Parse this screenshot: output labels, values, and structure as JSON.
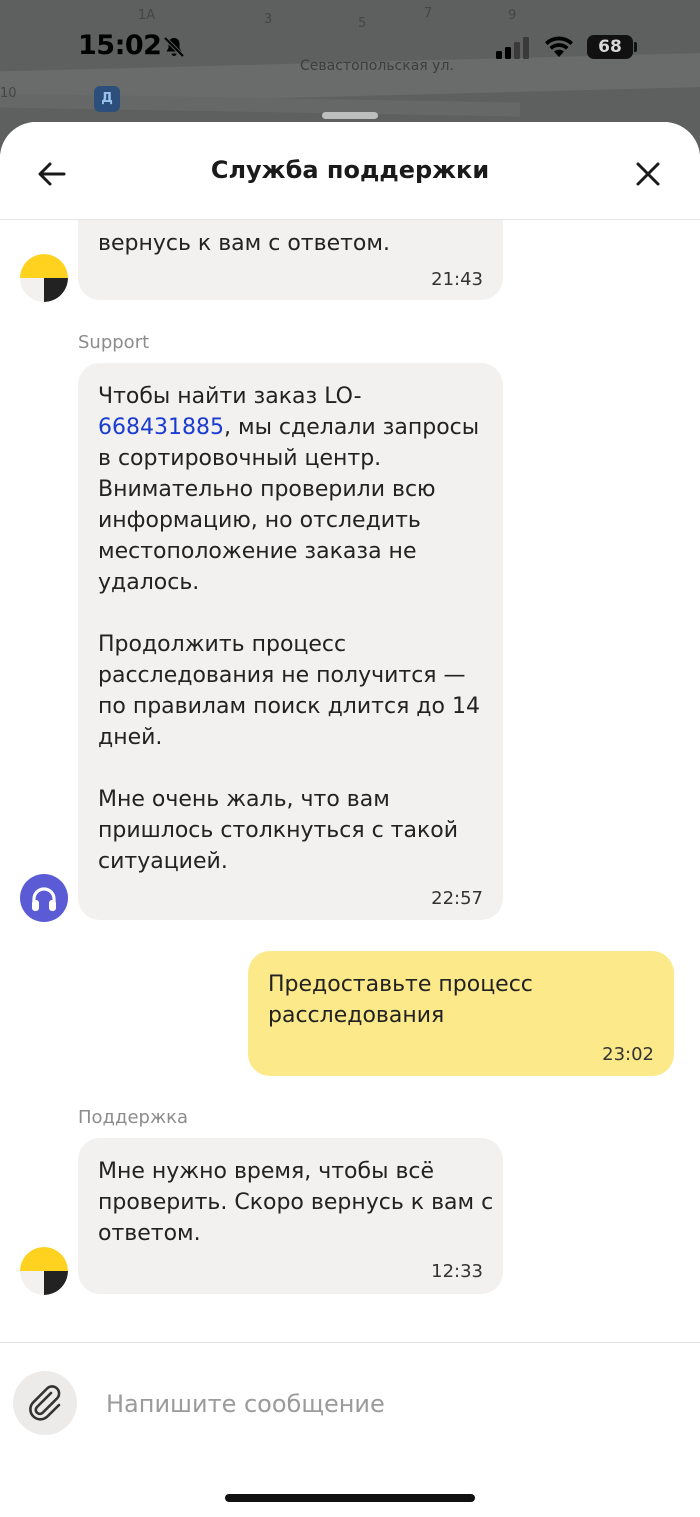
{
  "map": {
    "street": "Севастопольская ул.",
    "labels": [
      "1А",
      "3",
      "5",
      "7",
      "9",
      "10"
    ],
    "transit_badge": "Д"
  },
  "status_bar": {
    "time": "15:02",
    "battery": "68"
  },
  "header": {
    "title": "Служба поддержки"
  },
  "chat": {
    "partial_message": {
      "text": "вернусь к вам с ответом.",
      "time": "21:43"
    },
    "support_message": {
      "sender": "Support",
      "text_before_link": "Чтобы найти заказ LO-",
      "link": "668431885",
      "text_after_link": ", мы сделали запросы\nв сортировочный центр.\nВнимательно проверили всю\nинформацию, но отследить\nместоположение заказа не\nудалось.\n\nПродолжить процесс\nрасследования не получится —\nпо правилам поиск длится до 14\nдней.\n\nМне очень жаль, что вам\nпришлось столкнуться с такой\nситуацией.",
      "time": "22:57"
    },
    "user_message": {
      "text": "Предоставьте процесс\nрасследования",
      "time": "23:02"
    },
    "bot_message": {
      "sender": "Поддержка",
      "text": "Мне нужно время, чтобы всё\nпроверить. Скоро вернусь к вам с\nответом.",
      "time": "12:33"
    }
  },
  "composer": {
    "placeholder": "Напишите сообщение"
  },
  "colors": {
    "user_bubble": "#fce98a",
    "support_bubble": "#f2f1ef",
    "link": "#1a3cd0",
    "support_avatar": "#5b5bd6",
    "brand_yellow": "#ffd21f"
  },
  "icons": {
    "back": "arrow-left-icon",
    "close": "close-icon",
    "attach": "paperclip-icon",
    "support_avatar": "headphones-icon",
    "bot_avatar": "yandex-logo-icon"
  }
}
